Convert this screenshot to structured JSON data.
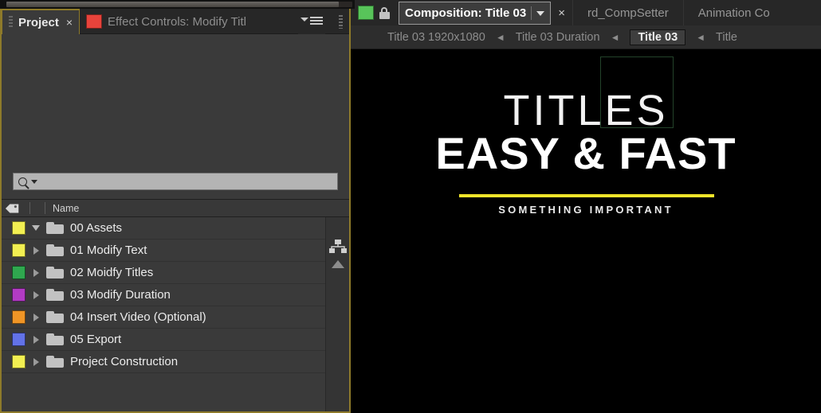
{
  "project_panel": {
    "tabs": [
      {
        "label": "Project",
        "active": true,
        "closable": true,
        "icon": null
      },
      {
        "label": "Effect Controls: Modify Titl",
        "active": false,
        "closable": false,
        "icon": "red-swatch"
      }
    ],
    "panel_menu_icon": "panel-menu-icon",
    "search": {
      "value": "",
      "placeholder": "",
      "icon": "search-icon",
      "dropdown_icon": "chevron-down-icon"
    },
    "columns": {
      "tag_icon": "label-tag-icon",
      "name": "Name"
    },
    "rail": {
      "hierarchy_icon": "hierarchy-icon",
      "scroll_up_icon": "scroll-up-arrow-icon"
    },
    "items": [
      {
        "label": "00 Assets",
        "color": "#f2ef52",
        "expanded": true
      },
      {
        "label": "01 Modify Text",
        "color": "#f2ef52",
        "expanded": false
      },
      {
        "label": "02 Moidfy Titles",
        "color": "#2fa84f",
        "expanded": false
      },
      {
        "label": "03 Modify Duration",
        "color": "#b23bc4",
        "expanded": false
      },
      {
        "label": "04 Insert Video (Optional)",
        "color": "#f09526",
        "expanded": false
      },
      {
        "label": "05 Export",
        "color": "#6272e8",
        "expanded": false
      },
      {
        "label": "Project Construction",
        "color": "#f2ef52",
        "expanded": false
      }
    ]
  },
  "composition_panel": {
    "color_swatch": "#58c45a",
    "lock_icon": "lock-icon",
    "tabs": [
      {
        "label": "Composition: Title 03",
        "active": true,
        "has_caret": true,
        "closable": true
      },
      {
        "label": "rd_CompSetter",
        "active": false,
        "has_caret": false,
        "closable": false
      },
      {
        "label": "Animation Co",
        "active": false,
        "has_caret": false,
        "closable": false
      }
    ],
    "breadcrumb": [
      {
        "label": "Title 03 1920x1080",
        "current": false
      },
      {
        "label": "Title 03 Duration",
        "current": false
      },
      {
        "label": "Title 03",
        "current": true
      },
      {
        "label": "Title",
        "current": false
      }
    ],
    "breadcrumb_separator": "◄",
    "viewer": {
      "title_line": "TITLES",
      "headline": "EASY & FAST",
      "subtitle": "SOMETHING IMPORTANT",
      "accent_color": "#f2e52a",
      "background": "#000000",
      "selection_box_color": "#23432a"
    }
  }
}
